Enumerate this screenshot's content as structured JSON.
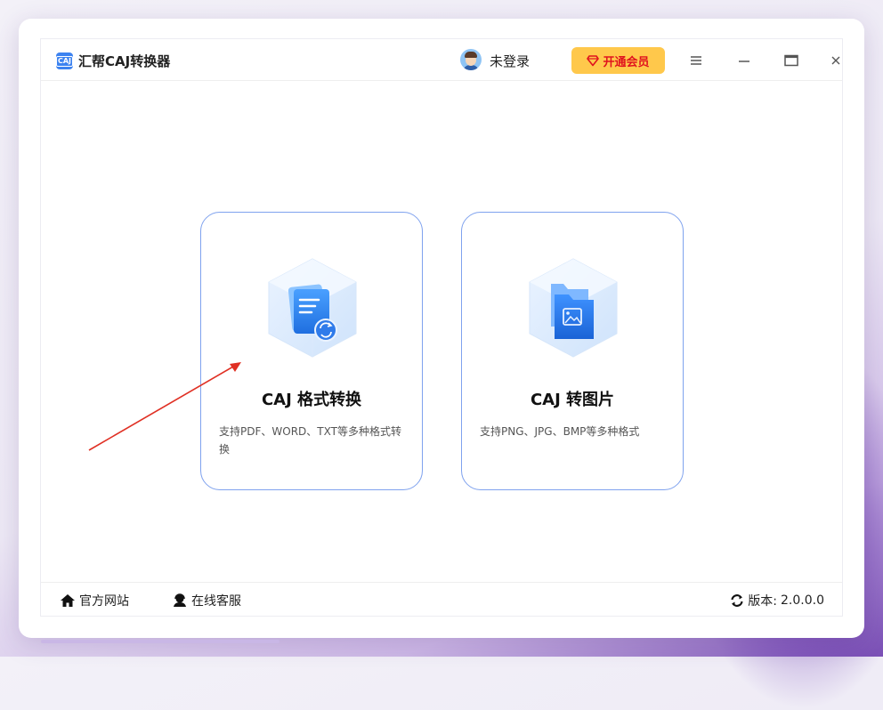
{
  "window": {
    "app_title": "汇帮CAJ转换器",
    "logo_text": "CAJ",
    "user": {
      "login_label": "未登录"
    },
    "vip_button": {
      "label": "开通会员"
    },
    "controls": {
      "menu": "menu-icon",
      "minimize": "minimize-icon",
      "maximize": "maximize-icon",
      "close": "close-icon"
    }
  },
  "cards": [
    {
      "title": "CAJ 格式转换",
      "description": "支持PDF、WORD、TXT等多种格式转换",
      "icon": "document-convert-icon"
    },
    {
      "title": "CAJ 转图片",
      "description": "支持PNG、JPG、BMP等多种格式",
      "icon": "folder-image-icon"
    }
  ],
  "footer": {
    "site_label": "官方网站",
    "service_label": "在线客服",
    "version_label": "版本:",
    "version_value": "2.0.0.0"
  },
  "colors": {
    "accent": "#3d83f0",
    "card_border": "#7fa2ee",
    "vip_bg": "#ffc84b",
    "vip_text": "#e0121e",
    "annotation_arrow": "#e03024"
  }
}
